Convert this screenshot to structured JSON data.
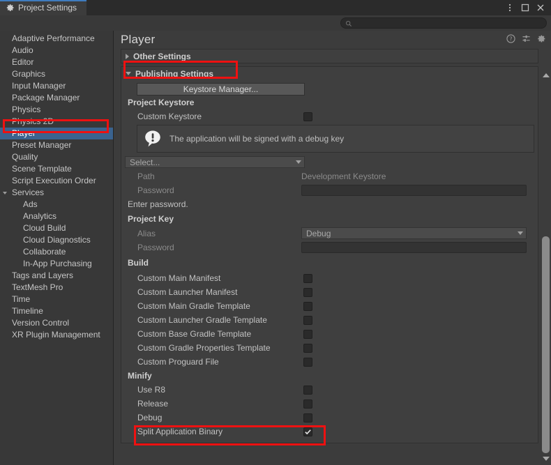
{
  "window": {
    "tab_label": "Project Settings",
    "tab_icon": "gear-icon",
    "controls": {
      "menu": "kebab-menu-icon",
      "maximize": "maximize-icon",
      "close": "close-icon"
    }
  },
  "search": {
    "placeholder": "",
    "value": "",
    "icon": "search-icon"
  },
  "sidebar": {
    "items": [
      {
        "label": "Adaptive Performance",
        "level": 0,
        "selected": false,
        "arrow": "none"
      },
      {
        "label": "Audio",
        "level": 0,
        "selected": false,
        "arrow": "none"
      },
      {
        "label": "Editor",
        "level": 0,
        "selected": false,
        "arrow": "none"
      },
      {
        "label": "Graphics",
        "level": 0,
        "selected": false,
        "arrow": "none"
      },
      {
        "label": "Input Manager",
        "level": 0,
        "selected": false,
        "arrow": "none"
      },
      {
        "label": "Package Manager",
        "level": 0,
        "selected": false,
        "arrow": "none"
      },
      {
        "label": "Physics",
        "level": 0,
        "selected": false,
        "arrow": "none"
      },
      {
        "label": "Physics 2D",
        "level": 0,
        "selected": false,
        "arrow": "none"
      },
      {
        "label": "Player",
        "level": 0,
        "selected": true,
        "arrow": "none"
      },
      {
        "label": "Preset Manager",
        "level": 0,
        "selected": false,
        "arrow": "none"
      },
      {
        "label": "Quality",
        "level": 0,
        "selected": false,
        "arrow": "none"
      },
      {
        "label": "Scene Template",
        "level": 0,
        "selected": false,
        "arrow": "none"
      },
      {
        "label": "Script Execution Order",
        "level": 0,
        "selected": false,
        "arrow": "none"
      },
      {
        "label": "Services",
        "level": 0,
        "selected": false,
        "arrow": "open"
      },
      {
        "label": "Ads",
        "level": 1,
        "selected": false,
        "arrow": "none"
      },
      {
        "label": "Analytics",
        "level": 1,
        "selected": false,
        "arrow": "none"
      },
      {
        "label": "Cloud Build",
        "level": 1,
        "selected": false,
        "arrow": "none"
      },
      {
        "label": "Cloud Diagnostics",
        "level": 1,
        "selected": false,
        "arrow": "none"
      },
      {
        "label": "Collaborate",
        "level": 1,
        "selected": false,
        "arrow": "none"
      },
      {
        "label": "In-App Purchasing",
        "level": 1,
        "selected": false,
        "arrow": "none"
      },
      {
        "label": "Tags and Layers",
        "level": 0,
        "selected": false,
        "arrow": "none"
      },
      {
        "label": "TextMesh Pro",
        "level": 0,
        "selected": false,
        "arrow": "none"
      },
      {
        "label": "Time",
        "level": 0,
        "selected": false,
        "arrow": "none"
      },
      {
        "label": "Timeline",
        "level": 0,
        "selected": false,
        "arrow": "none"
      },
      {
        "label": "Version Control",
        "level": 0,
        "selected": false,
        "arrow": "none"
      },
      {
        "label": "XR Plugin Management",
        "level": 0,
        "selected": false,
        "arrow": "none"
      }
    ]
  },
  "page": {
    "title": "Player",
    "header_icons": [
      "help-icon",
      "preset-sliders-icon",
      "gear-icon"
    ]
  },
  "sections": {
    "other_settings": {
      "label": "Other Settings",
      "expanded": false
    },
    "publishing_settings": {
      "label": "Publishing Settings",
      "expanded": true
    }
  },
  "publishing": {
    "keystore_manager_button": "Keystore Manager...",
    "project_keystore_group": "Project Keystore",
    "custom_keystore_label": "Custom Keystore",
    "custom_keystore_checked": false,
    "warning_text": "The application will be signed with a debug key",
    "warning_icon": "warning-bubble-icon",
    "keystore_select_value": "Select...",
    "path_label": "Path",
    "path_value": "Development Keystore",
    "keystore_password_label": "Password",
    "keystore_password_value": "",
    "password_note": "Enter password.",
    "project_key_group": "Project Key",
    "alias_label": "Alias",
    "alias_value": "Debug",
    "key_password_label": "Password",
    "key_password_value": ""
  },
  "build": {
    "group": "Build",
    "options": [
      {
        "label": "Custom Main Manifest",
        "checked": false
      },
      {
        "label": "Custom Launcher Manifest",
        "checked": false
      },
      {
        "label": "Custom Main Gradle Template",
        "checked": false
      },
      {
        "label": "Custom Launcher Gradle Template",
        "checked": false
      },
      {
        "label": "Custom Base Gradle Template",
        "checked": false
      },
      {
        "label": "Custom Gradle Properties Template",
        "checked": false
      },
      {
        "label": "Custom Proguard File",
        "checked": false
      }
    ]
  },
  "minify": {
    "group": "Minify",
    "options": [
      {
        "label": "Use R8",
        "checked": false
      },
      {
        "label": "Release",
        "checked": false
      },
      {
        "label": "Debug",
        "checked": false
      }
    ],
    "split_application_binary": {
      "label": "Split Application Binary",
      "checked": true
    }
  },
  "annotations": {
    "color": "#ee1111",
    "boxes": [
      "sidebar-player",
      "publishing-settings-header",
      "split-application-binary-row"
    ]
  }
}
